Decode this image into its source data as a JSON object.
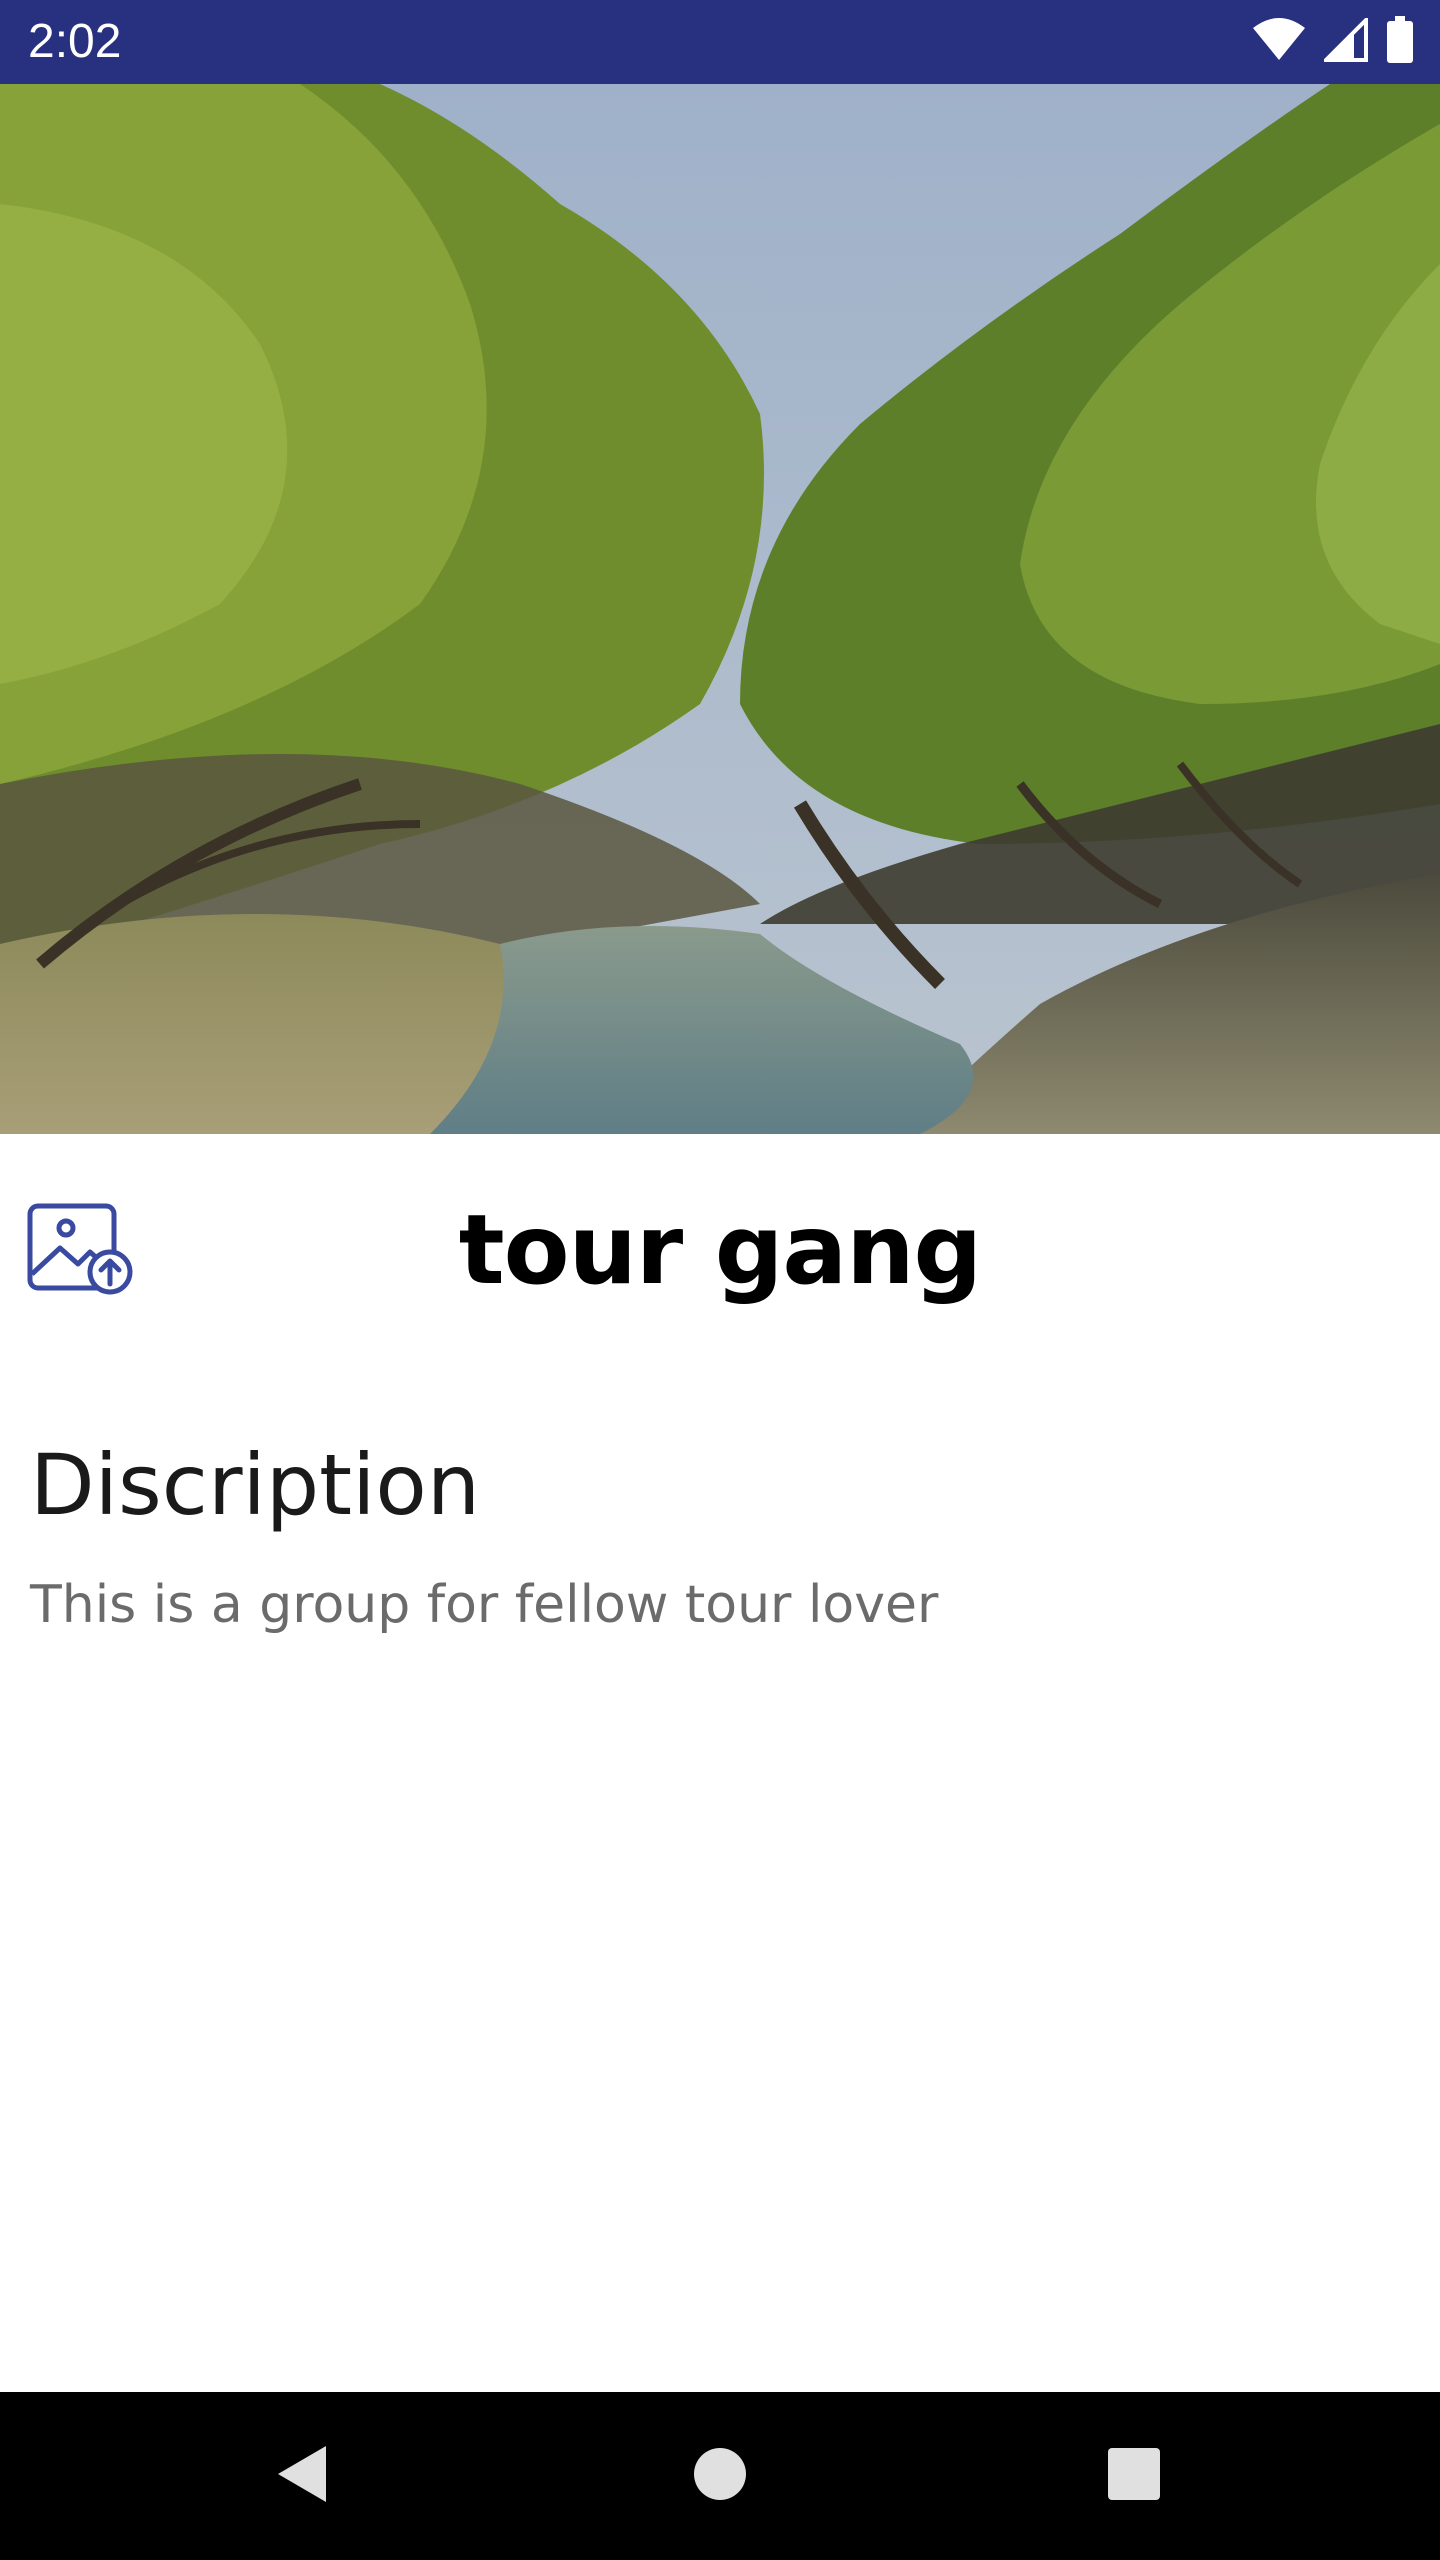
{
  "status_bar": {
    "time": "2:02",
    "background": "#283080",
    "icons": [
      "wifi-icon",
      "signal-icon",
      "battery-icon"
    ]
  },
  "hero": {
    "description": "mangrove-forest-river-photo"
  },
  "header": {
    "upload_icon": "image-upload-icon",
    "title": "tour gang",
    "accent_color": "#3a4aa0"
  },
  "description": {
    "heading": "Discription",
    "text": "This is a group for fellow tour lover"
  },
  "nav_bar": {
    "buttons": [
      "back-icon",
      "home-icon",
      "recents-icon"
    ]
  }
}
